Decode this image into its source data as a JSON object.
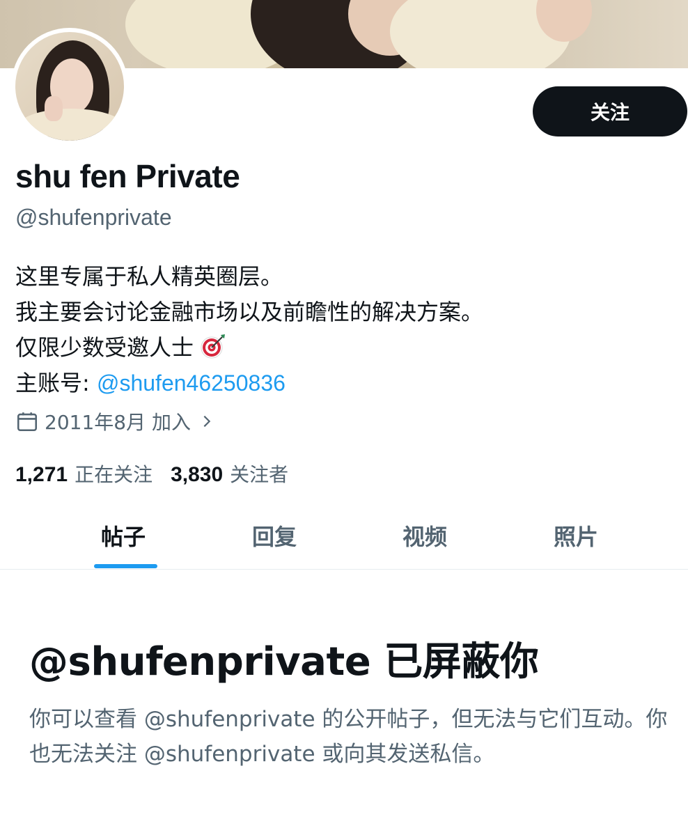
{
  "header": {
    "follow_label": "关注"
  },
  "profile": {
    "display_name": "shu fen Private",
    "handle": "@shufenprivate",
    "bio_lines": [
      "这里专属于私人精英圈层。",
      "我主要会讨论金融市场以及前瞻性的解决方案。",
      "仅限少数受邀人士"
    ],
    "main_account_label": "主账号: ",
    "main_account_link": "@shufen46250836",
    "joined": "2011年8月 加入",
    "following_count": "1,271",
    "following_label": "正在关注",
    "followers_count": "3,830",
    "followers_label": "关注者"
  },
  "tabs": [
    {
      "label": "帖子",
      "active": true
    },
    {
      "label": "回复",
      "active": false
    },
    {
      "label": "视频",
      "active": false
    },
    {
      "label": "照片",
      "active": false
    }
  ],
  "blocked": {
    "title": "@shufenprivate 已屏蔽你",
    "description": "你可以查看 @shufenprivate 的公开帖子，但无法与它们互动。你也无法关注 @shufenprivate 或向其发送私信。"
  },
  "icons": {
    "bio_emoji": "target-icon",
    "joined": "calendar-icon",
    "joined_more": "chevron-right-icon"
  },
  "colors": {
    "accent": "#1d9bf0",
    "text_primary": "#0f1419",
    "text_secondary": "#536471",
    "follow_button": "#0f1419"
  }
}
